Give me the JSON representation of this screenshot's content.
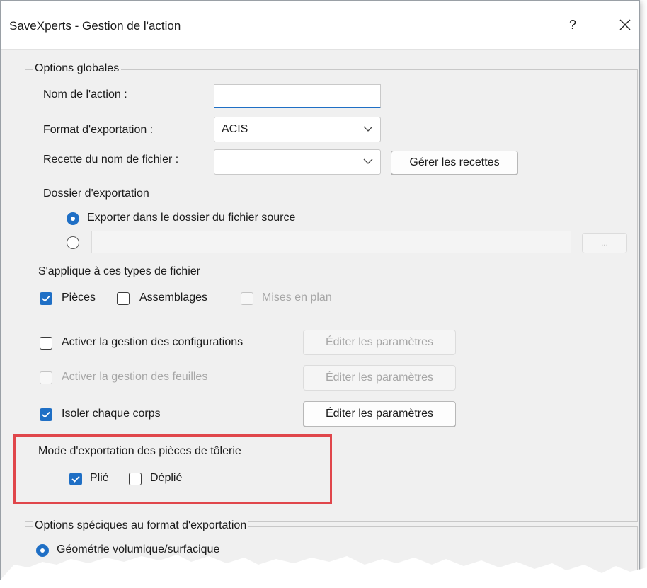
{
  "window": {
    "title": "SaveXperts - Gestion de l'action",
    "help_label": "?"
  },
  "global_options": {
    "legend": "Options globales",
    "action_name_label": "Nom de l'action :",
    "action_name_value": "",
    "export_format_label": "Format d'exportation :",
    "export_format_value": "ACIS",
    "filename_recipe_label": "Recette du nom de fichier :",
    "filename_recipe_value": "",
    "manage_recipes_button": "Gérer les recettes",
    "export_folder_label": "Dossier d'exportation",
    "export_folder_source_option": "Exporter dans le dossier du fichier source",
    "custom_folder_value": "",
    "browse_button": "...",
    "file_types_label": "S'applique à ces types de fichier",
    "file_types": [
      {
        "label": "Pièces",
        "checked": true,
        "enabled": true
      },
      {
        "label": "Assemblages",
        "checked": false,
        "enabled": true
      },
      {
        "label": "Mises en plan",
        "checked": false,
        "enabled": false
      }
    ],
    "config_management": {
      "label": "Activer la gestion des configurations",
      "checked": false,
      "enabled": true,
      "button": "Éditer les paramètres",
      "button_enabled": false
    },
    "sheet_management": {
      "label": "Activer la gestion des feuilles",
      "checked": false,
      "enabled": false,
      "button": "Éditer les paramètres",
      "button_enabled": false
    },
    "isolate_bodies": {
      "label": "Isoler chaque corps",
      "checked": true,
      "enabled": true,
      "button": "Éditer les paramètres",
      "button_enabled": true
    },
    "sheetmetal_mode_label": "Mode d'exportation des pièces de tôlerie",
    "sheetmetal_modes": [
      {
        "label": "Plié",
        "checked": true
      },
      {
        "label": "Déplié",
        "checked": false
      }
    ]
  },
  "format_options": {
    "legend": "Options spéciques au format d'exportation",
    "geometry_option": "Géométrie volumique/surfacique"
  },
  "colors": {
    "accent": "#1f6fc5",
    "highlight": "#e0464b"
  }
}
